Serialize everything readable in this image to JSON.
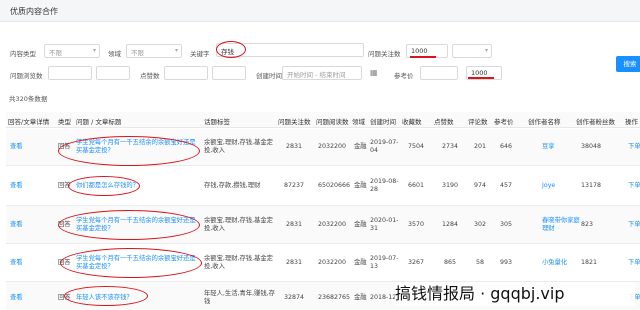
{
  "header": {
    "title": "优质内容合作"
  },
  "filters": {
    "content_type_label": "内容类型",
    "content_type_value": "不限",
    "domain_label": "领域",
    "domain_value": "不限",
    "keyword_label": "关键字",
    "keyword_value": "存钱",
    "followers_label": "问题关注数",
    "followers_min": "1000",
    "views_label": "问题浏览数",
    "likes_label": "点赞数",
    "time_label": "创建时间",
    "time_start": "开始时间",
    "time_sep": "-",
    "time_end": "结束时间",
    "ref_price_label": "参考价",
    "ref_price_max": "1000"
  },
  "search_button": "搜索",
  "total_label": "共320条数据",
  "table": {
    "columns": [
      "回答/文章详情",
      "类型",
      "问题 / 文章标题",
      "话题标签",
      "问题关注数",
      "问题阅读数",
      "领域",
      "创建时间",
      "收藏数",
      "点赞数",
      "评论数",
      "参考价",
      "创作者名称",
      "创作者粉丝数",
      "操作"
    ],
    "rows": [
      {
        "view": "查看",
        "type": "回答",
        "title": "学生党每个月有一千五结余的余额宝好还是买基金定投？",
        "tags": "余额宝,理财,存钱,基金定投,收入",
        "followers": "2831",
        "reads": "2032200",
        "domain": "金融",
        "created": "2019-07-04",
        "favorites": "7504",
        "likes": "2734",
        "comments": "201",
        "price": "646",
        "creator": "豆享",
        "fans": "38048",
        "action": "下单"
      },
      {
        "view": "查看",
        "type": "回答",
        "title": "你们都是怎么存钱的？",
        "tags": "存钱,存款,攒钱,理财",
        "followers": "87237",
        "reads": "65020666",
        "domain": "金融",
        "created": "2019-08-28",
        "favorites": "6601",
        "likes": "3190",
        "comments": "974",
        "price": "457",
        "creator": "Joye",
        "fans": "13178",
        "action": "下单"
      },
      {
        "view": "查看",
        "type": "回答",
        "title": "学生党每个月有一千五结余的余额宝好还是买基金定投？",
        "tags": "余额宝,理财,存钱,基金定投,收入",
        "followers": "2831",
        "reads": "2032200",
        "domain": "金融",
        "created": "2020-01-31",
        "favorites": "3570",
        "likes": "1284",
        "comments": "302",
        "price": "305",
        "creator": "春晓带你家庭理财",
        "fans": "823",
        "action": "下单"
      },
      {
        "view": "查看",
        "type": "回答",
        "title": "学生党每个月有一千五结余的余额宝好还是买基金定投？",
        "tags": "余额宝,理财,存钱,基金定投,收入",
        "followers": "2831",
        "reads": "2032200",
        "domain": "金融",
        "created": "2019-07-13",
        "favorites": "3267",
        "likes": "865",
        "comments": "58",
        "price": "993",
        "creator": "小兔量化",
        "fans": "1821",
        "action": "下单"
      },
      {
        "view": "查看",
        "type": "回答",
        "title": "年轻人该不该存钱？",
        "tags": "年轻人,生活,青年,赚钱,存钱",
        "followers": "32874",
        "reads": "23682765",
        "domain": "金融",
        "created": "2018-12-",
        "favorites": "",
        "likes": "",
        "comments": "",
        "price": "",
        "creator": "",
        "fans": "",
        "action": "下单"
      }
    ]
  },
  "watermark": "搞钱情报局 · gqqbj.vip",
  "annotation_color": "#d9141b"
}
